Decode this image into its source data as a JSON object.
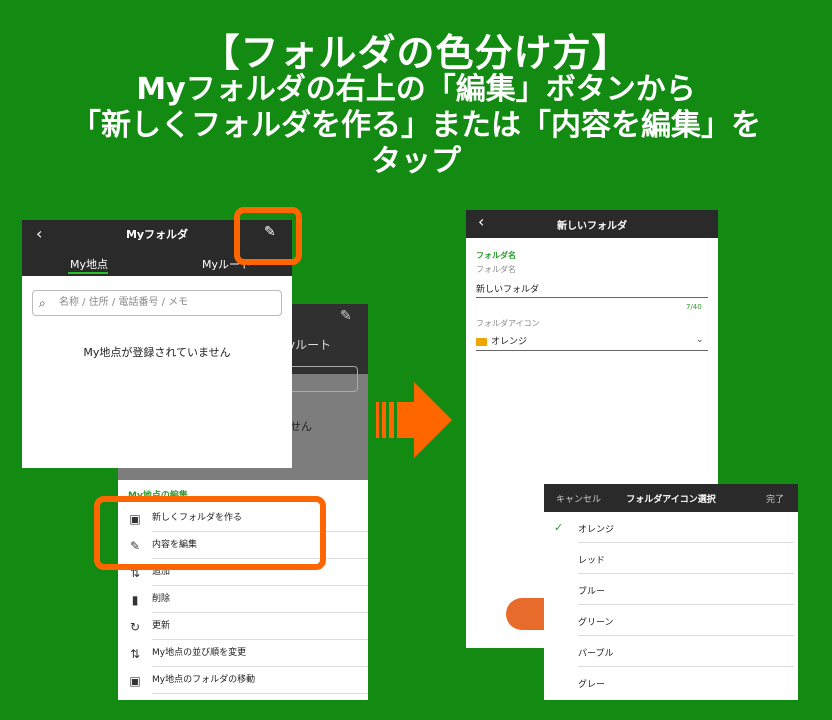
{
  "banner": {
    "title": "【フォルダの色分け方】",
    "line1": "Myフォルダの右上の「編集」ボタンから",
    "line2": "「新しくフォルダを作る」または「内容を編集」を",
    "line3": "タップ"
  },
  "left_back": {
    "tab_fragment": "yルート",
    "empty_fragment": "せん",
    "sheet_title": "My地点の編集",
    "items": [
      {
        "icon": "folder-add-icon",
        "label": "新しくフォルダを作る"
      },
      {
        "icon": "pencil-icon",
        "label": "内容を編集"
      },
      {
        "icon": "add-icon",
        "label": "追加"
      },
      {
        "icon": "trash-icon",
        "label": "削除"
      },
      {
        "icon": "refresh-icon",
        "label": "更新"
      },
      {
        "icon": "sort-icon",
        "label": "My地点の並び順を変更"
      },
      {
        "icon": "folder-move-icon",
        "label": "My地点のフォルダの移動"
      }
    ]
  },
  "left_front": {
    "title": "Myフォルダ",
    "tabs": [
      "My地点",
      "Myルート"
    ],
    "search_placeholder": "名称 / 住所 / 電話番号 / メモ",
    "empty_message": "My地点が登録されていません"
  },
  "right": {
    "title": "新しいフォルダ",
    "section": "フォルダ名",
    "name_label": "フォルダ名",
    "name_value": "新しいフォルダ",
    "counter": "7/40",
    "icon_label": "フォルダアイコン",
    "icon_value": "オレンジ"
  },
  "picker": {
    "cancel": "キャンセル",
    "title": "フォルダアイコン選択",
    "done": "完了",
    "options": [
      "オレンジ",
      "レッド",
      "ブルー",
      "グリーン",
      "パープル",
      "グレー"
    ],
    "selected": "オレンジ"
  },
  "colors": {
    "background": "#138a12",
    "highlight": "#ff6600",
    "accent_green": "#2b9b2b",
    "header": "#2a2a2a"
  }
}
